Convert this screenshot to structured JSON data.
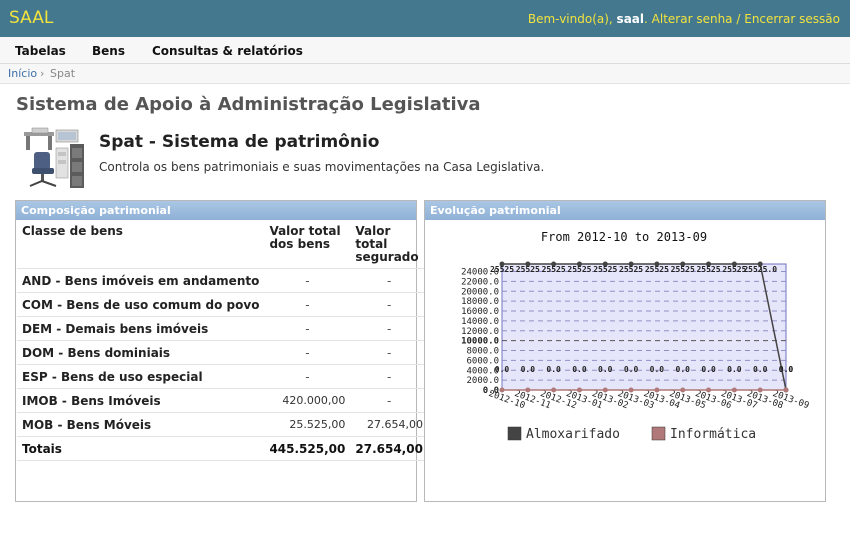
{
  "header": {
    "app_title": "SAAL",
    "welcome": "Bem-vindo(a),",
    "username": "saal",
    "change_password": "Alterar senha",
    "separator": "/",
    "logout": "Encerrar sessão"
  },
  "menu": {
    "items": [
      {
        "label": "Tabelas"
      },
      {
        "label": "Bens"
      },
      {
        "label": "Consultas & relatórios"
      }
    ]
  },
  "breadcrumb": {
    "home": "Início",
    "sep": "›",
    "current": "Spat"
  },
  "page": {
    "title": "Sistema de Apoio à Administração Legislativa"
  },
  "module": {
    "title": "Spat - Sistema de patrimônio",
    "description": "Controla os bens patrimoniais e suas movimentações na Casa Legislativa.",
    "image_icon": "office-furniture-icon"
  },
  "composition": {
    "title": "Composição patrimonial",
    "headers": {
      "classe": "Classe de bens",
      "valor_total": "Valor total dos bens",
      "valor_segurado": "Valor total segurado"
    },
    "rows": [
      {
        "classe": "AND - Bens imóveis em andamento",
        "valor_total": "-",
        "valor_segurado": "-"
      },
      {
        "classe": "COM - Bens de uso comum do povo",
        "valor_total": "-",
        "valor_segurado": "-"
      },
      {
        "classe": "DEM - Demais bens imóveis",
        "valor_total": "-",
        "valor_segurado": "-"
      },
      {
        "classe": "DOM - Bens dominiais",
        "valor_total": "-",
        "valor_segurado": "-"
      },
      {
        "classe": "ESP - Bens de uso especial",
        "valor_total": "-",
        "valor_segurado": "-"
      },
      {
        "classe": "IMOB - Bens Imóveis",
        "valor_total": "420.000,00",
        "valor_segurado": "-"
      },
      {
        "classe": "MOB - Bens Móveis",
        "valor_total": "25.525,00",
        "valor_segurado": "27.654,00"
      }
    ],
    "total": {
      "classe": "Totais",
      "valor_total": "445.525,00",
      "valor_segurado": "27.654,00"
    }
  },
  "evolution": {
    "title": "Evolução patrimonial",
    "chart_data": {
      "type": "line",
      "title": "From 2012-10 to 2013-09",
      "categories": [
        "2012-10",
        "2012-11",
        "2012-12",
        "2013-01",
        "2013-02",
        "2013-03",
        "2013-04",
        "2013-05",
        "2013-06",
        "2013-07",
        "2013-08",
        "2013-09"
      ],
      "y_ticks": [
        "0.0",
        "2000.0",
        "4000.0",
        "6000.0",
        "8000.0",
        "10000.0",
        "12000.0",
        "14000.0",
        "16000.0",
        "18000.0",
        "20000.0",
        "22000.0",
        "24000.0"
      ],
      "ylim": [
        0,
        25525
      ],
      "series": [
        {
          "name": "Almoxarifado",
          "color": "#444444",
          "values": [
            25525,
            25525,
            25525,
            25525,
            25525,
            25525,
            25525,
            25525,
            25525,
            25525,
            25525,
            0
          ],
          "labels": [
            "25525",
            "25525",
            "25525",
            "25525",
            "25525",
            "25525",
            "25525",
            "25525",
            "25525",
            "25525",
            "25525.0",
            "0.0"
          ]
        },
        {
          "name": "Informática",
          "color": "#b07878",
          "values": [
            0,
            0,
            0,
            0,
            0,
            0,
            0,
            0,
            0,
            0,
            0,
            0
          ],
          "labels": [
            "0.0",
            "0.0",
            "0.0",
            "0.0",
            "0.0",
            "0.0",
            "0.0",
            "0.0",
            "0.0",
            "0.0",
            "0.0",
            "0.0"
          ]
        }
      ],
      "grid": true,
      "background": "#e6e6fa",
      "legend_position": "bottom"
    }
  }
}
